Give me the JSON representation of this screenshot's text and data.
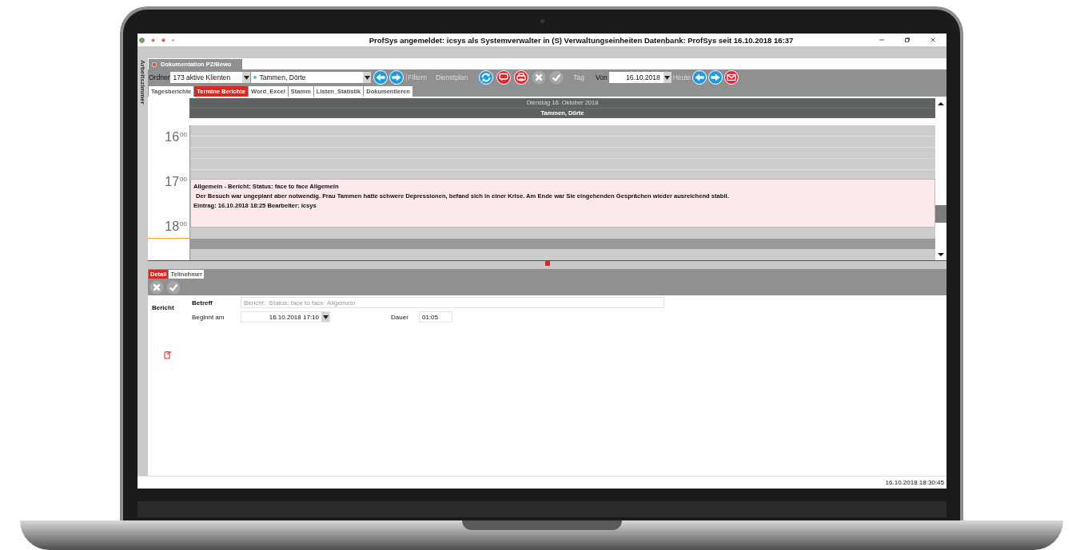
{
  "window": {
    "title": "ProfSys angemeldet: icsys als Systemverwalter in (S) Verwaltungseinheiten Datenbank: ProfSys seit 16.10.2018 16:37"
  },
  "side_panel": {
    "label": "Arbeitszimmer"
  },
  "document_tab": {
    "label": "Dokumentation PZ/Bewo"
  },
  "toolbar": {
    "folder_label": "Ordner",
    "folder_value": "173 aktive Klienten",
    "client_value": "Tammen, Dörte",
    "filter_label": "Filtern",
    "roster_label": "Dienstplan",
    "day_label": "Tag",
    "from_label": "Von",
    "from_value": "16.10.2018",
    "today_label": "Heute"
  },
  "tabs": [
    {
      "label": "Tagesberichte",
      "selected": false
    },
    {
      "label": "Termine Berichte",
      "selected": true
    },
    {
      "label": "Word_Excel",
      "selected": false
    },
    {
      "label": "Stamm",
      "selected": false
    },
    {
      "label": "Listen_Statistik",
      "selected": false
    },
    {
      "label": "Dokumentieren",
      "selected": false
    }
  ],
  "calendar": {
    "date": "Dienstag 16. Oktober 2018",
    "person": "Tammen, Dörte",
    "hours": [
      {
        "hour": "16",
        "minutes": "00"
      },
      {
        "hour": "17",
        "minutes": "00"
      },
      {
        "hour": "18",
        "minutes": "00"
      }
    ],
    "event": {
      "title": "Allgemein - Bericht:  Status: face to face  Allgemein",
      "text": "Der Besuch war ungeplant aber notwendig. Frau Tammen hatte schwere Depressionen, befand sich in einer Krise. Am Ende war Sie eingehenden Gesprächen wieder ausreichend stabil.",
      "entry": "Eintrag: 16.10.2018 18:25 Bearbeiter: icsys"
    }
  },
  "detail_tabs": [
    {
      "label": "Detail",
      "selected": true
    },
    {
      "label": "Teilnehmer",
      "selected": false
    }
  ],
  "form": {
    "section": "Bericht",
    "subject_label": "Betreff",
    "subject_placeholder": "Bericht:  Status: face to face  Allgemein",
    "start_label": "Beginnt am",
    "start_value": "16.10.2018 17:10",
    "duration_label": "Dauer",
    "duration_value": "01:05"
  },
  "status_bar": {
    "timestamp": "16.10.2018 18:30:45"
  }
}
